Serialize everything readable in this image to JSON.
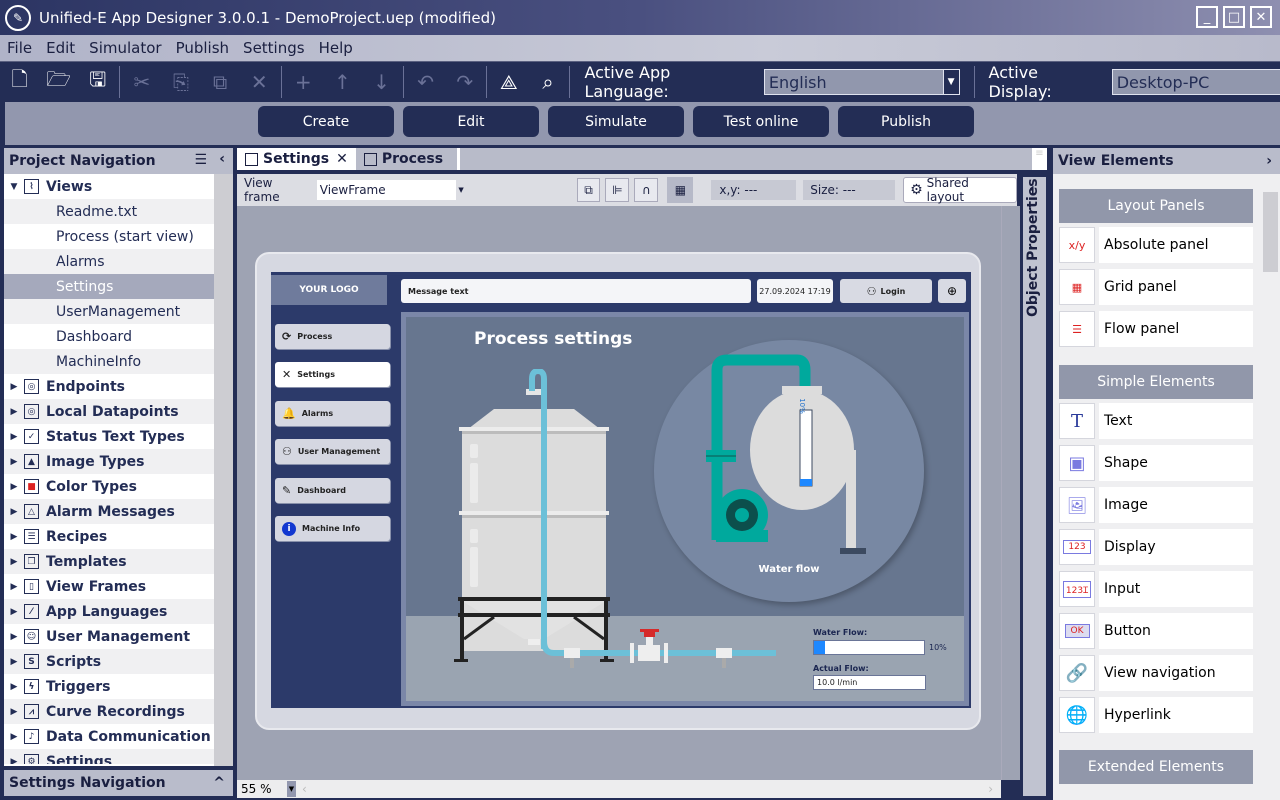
{
  "window": {
    "title": "Unified-E App Designer 3.0.0.1 - DemoProject.uep  (modified)",
    "controls": [
      "minimize",
      "maximize",
      "close"
    ]
  },
  "menu": [
    "File",
    "Edit",
    "Simulator",
    "Publish",
    "Settings",
    "Help"
  ],
  "toolbar": {
    "icons": [
      "new-file",
      "open-folder",
      "save",
      "cut",
      "copy",
      "paste-special",
      "delete",
      "add",
      "move-up",
      "move-down",
      "undo",
      "redo",
      "network",
      "search"
    ],
    "language_label": "Active App Language:",
    "language_value": "English",
    "display_label": "Active Display:",
    "display_value": "Desktop-PC"
  },
  "modes": [
    "Create",
    "Edit",
    "Simulate",
    "Test online",
    "Publish"
  ],
  "project_nav": {
    "title": "Project Navigation",
    "views_label": "Views",
    "views": [
      "Readme.txt",
      "Process (start view)",
      "Alarms",
      "Settings",
      "UserManagement",
      "Dashboard",
      "MachineInfo"
    ],
    "selected_view": "Settings",
    "sections": [
      "Endpoints",
      "Local Datapoints",
      "Status Text Types",
      "Image Types",
      "Color Types",
      "Alarm Messages",
      "Recipes",
      "Templates",
      "View Frames",
      "App Languages",
      "User Management",
      "Scripts",
      "Triggers",
      "Curve Recordings",
      "Data Communication",
      "Settings"
    ]
  },
  "settings_nav": {
    "title": "Settings Navigation"
  },
  "editor": {
    "tabs": [
      {
        "label": "Settings",
        "active": true,
        "closable": true
      },
      {
        "label": "Process",
        "active": false
      }
    ],
    "view_frame_label": "View frame",
    "view_frame_value": "ViewFrame",
    "xy_label": "x,y: ---",
    "size_label": "Size: ---",
    "shared_layout": "Shared layout",
    "zoom": "55 %"
  },
  "hmi": {
    "logo": "YOUR LOGO",
    "message": "Message text",
    "datetime": "27.09.2024 17:19",
    "login": "Login",
    "nav": [
      "Process",
      "Settings",
      "Alarms",
      "User Management",
      "Dashboard",
      "Machine Info"
    ],
    "active_nav": "Settings",
    "title": "Process settings",
    "water_flow_caption": "Water flow",
    "tank_level_label": "10%",
    "water_flow_label": "Water Flow:",
    "water_flow_pct": 10,
    "water_flow_text": "10%",
    "actual_flow_label": "Actual Flow:",
    "actual_flow_value": "10.0  l/min",
    "colors": {
      "pipe": "#6cc0d8",
      "pump": "#00a99d",
      "valve": "#d62a2a",
      "bar_fill": "#1e88ff"
    }
  },
  "object_properties": {
    "title": "Object Properties"
  },
  "view_elements": {
    "title": "View Elements",
    "layout_panels_title": "Layout Panels",
    "layout_panels": [
      "Absolute panel",
      "Grid panel",
      "Flow panel"
    ],
    "simple_elements_title": "Simple Elements",
    "simple_elements": [
      "Text",
      "Shape",
      "Image",
      "Display",
      "Input",
      "Button",
      "View navigation",
      "Hyperlink"
    ],
    "extended_elements_title": "Extended Elements"
  }
}
